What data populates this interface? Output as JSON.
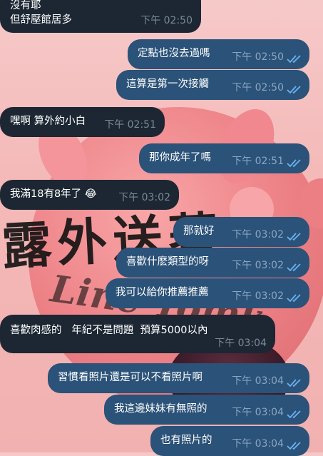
{
  "colors": {
    "incoming_bubble": "#1c2733",
    "outgoing_bubble": "#2b5278",
    "check_color": "#6ab3f3"
  },
  "messages": [
    {
      "id": "m1",
      "direction": "in",
      "lines": [
        "沒有耶",
        "但舒壓館居多"
      ],
      "time": "下午 02:50"
    },
    {
      "id": "m2",
      "direction": "out",
      "lines": [
        "定點也沒去過嗎"
      ],
      "time": "下午 02:50",
      "read": true
    },
    {
      "id": "m3",
      "direction": "out",
      "lines": [
        "這算是第一次接觸"
      ],
      "time": "下午 02:50",
      "read": true
    },
    {
      "id": "m4",
      "direction": "in",
      "lines": [
        "嘿啊 算外約小白"
      ],
      "time": "下午 02:51"
    },
    {
      "id": "m5",
      "direction": "out",
      "lines": [
        "那你成年了嗎"
      ],
      "time": "下午 02:51",
      "read": true
    },
    {
      "id": "m6",
      "direction": "in",
      "lines": [
        "我滿18有8年了 😂"
      ],
      "time": "下午 03:02"
    },
    {
      "id": "m7",
      "direction": "out",
      "lines": [
        "那就好"
      ],
      "time": "下午 03:02",
      "read": true
    },
    {
      "id": "m8",
      "direction": "out",
      "lines": [
        "喜歡什麽類型的呀"
      ],
      "time": "下午 03:02",
      "read": true
    },
    {
      "id": "m9",
      "direction": "out",
      "lines": [
        "我可以給你推薦推薦"
      ],
      "time": "下午 03:02",
      "read": true
    },
    {
      "id": "m10",
      "direction": "in",
      "lines": [
        "喜歡肉感的   年紀不是問題  預算5000以內"
      ],
      "time": "下午 03:04"
    },
    {
      "id": "m11",
      "direction": "out",
      "lines": [
        "習慣看照片還是可以不看照片啊"
      ],
      "time": "下午 03:04",
      "read": true
    },
    {
      "id": "m12",
      "direction": "out",
      "lines": [
        "我這邊妹妹有無照的"
      ],
      "time": "下午 03:04",
      "read": true
    },
    {
      "id": "m13",
      "direction": "out",
      "lines": [
        "也有照片的"
      ],
      "time": "下午 03:04",
      "read": true
    }
  ],
  "wallpaper": {
    "calligraphy_text": "露外送著",
    "script_text": "Line·Tomk"
  }
}
